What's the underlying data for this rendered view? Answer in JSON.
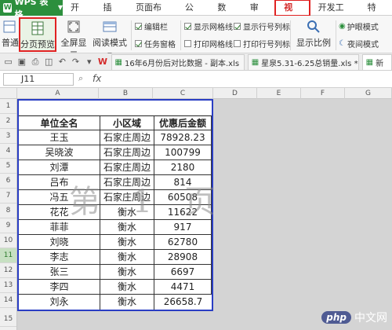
{
  "app": {
    "name": "WPS 表格"
  },
  "menu": {
    "tabs": [
      "开始",
      "插入",
      "页面布局",
      "公式",
      "数据",
      "审阅",
      "视图",
      "开发工具",
      "特色"
    ],
    "active": "视图"
  },
  "ribbon": {
    "normal": "普通",
    "page_break_preview": "分页预览",
    "full_screen": "全屏显示",
    "reading_mode": "阅读模式",
    "edit_bar": "编辑栏",
    "task_pane": "任务窗格",
    "show_gridlines": "显示网格线",
    "print_gridlines": "打印网格线",
    "show_row_col_headers": "显示行号列标",
    "print_row_col_headers": "打印行号列标",
    "show_ratio": "显示比例",
    "eye_protect": "护眼模式",
    "night_mode": "夜间模式"
  },
  "doc_tabs": [
    {
      "label": "16年6月份后对比数据 - 副本.xls"
    },
    {
      "label": "星泉5.31-6.25总销量.xls *"
    },
    {
      "label": "新"
    }
  ],
  "formula_bar": {
    "cell_ref": "J11",
    "fx": "fx",
    "value": ""
  },
  "columns": [
    "A",
    "B",
    "C",
    "D",
    "E",
    "F",
    "G"
  ],
  "rows": [
    "1",
    "2",
    "3",
    "4",
    "5",
    "6",
    "7",
    "8",
    "9",
    "10",
    "11",
    "12",
    "13",
    "14",
    "15"
  ],
  "table": {
    "headers": [
      "单位全名",
      "小区域",
      "优惠后金额"
    ],
    "rows": [
      [
        "王玉",
        "石家庄周边",
        "78928.23"
      ],
      [
        "吴晓波",
        "石家庄周边",
        "100799"
      ],
      [
        "刘潭",
        "石家庄周边",
        "2180"
      ],
      [
        "吕布",
        "石家庄周边",
        "814"
      ],
      [
        "冯五",
        "石家庄周边",
        "60508"
      ],
      [
        "花花",
        "衡水",
        "11622"
      ],
      [
        "菲菲",
        "衡水",
        "917"
      ],
      [
        "刘晓",
        "衡水",
        "62780"
      ],
      [
        "李志",
        "衡水",
        "28908"
      ],
      [
        "张三",
        "衡水",
        "6697"
      ],
      [
        "李四",
        "衡水",
        "4471"
      ],
      [
        "刘永",
        "衡水",
        "26658.7"
      ]
    ]
  },
  "watermark": "第 1 页",
  "brand": {
    "badge": "php",
    "text": "中文网"
  },
  "colors": {
    "accent": "#2c8f3d",
    "page_border": "#2a3ec4",
    "highlight": "#e02222"
  }
}
